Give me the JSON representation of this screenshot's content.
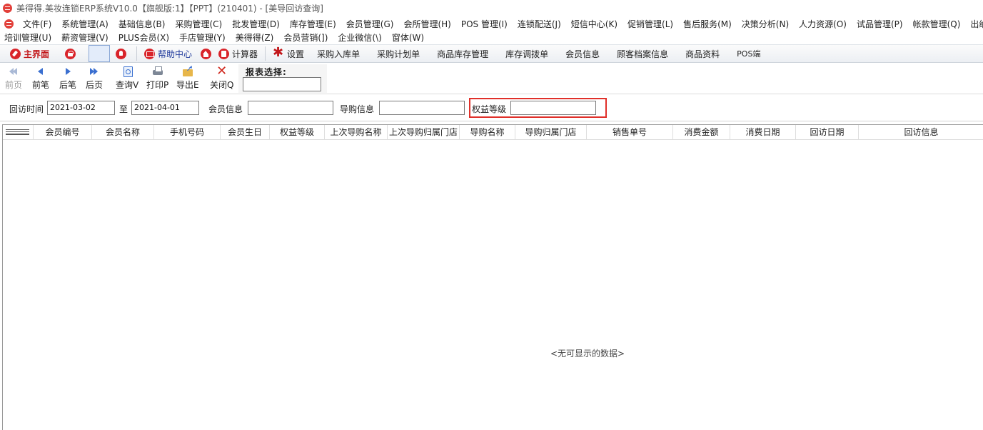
{
  "window": {
    "title": "美得得.美妆连锁ERP系统V10.0【旗舰版:1】【PPT】(210401) - [美导回访查询]"
  },
  "menu": {
    "row1": [
      "文件(F)",
      "系统管理(A)",
      "基础信息(B)",
      "采购管理(C)",
      "批发管理(D)",
      "库存管理(E)",
      "会员管理(G)",
      "会所管理(H)",
      "POS 管理(I)",
      "连锁配送(J)",
      "短信中心(K)",
      "促销管理(L)",
      "售后服务(M)",
      "决策分析(N)",
      "人力资源(O)",
      "试品管理(P)",
      "帐款管理(Q)",
      "出纳管理"
    ],
    "row2": [
      "培训管理(U)",
      "薪资管理(V)",
      "PLUS会员(X)",
      "手店管理(Y)",
      "美得得(Z)",
      "会员营销(])",
      "企业微信(\\)",
      "窗体(W)"
    ]
  },
  "quickbar": {
    "home": "主界面",
    "help": "帮助中心",
    "calculator": "计算器",
    "settings": "设置",
    "links": [
      "采购入库单",
      "采购计划单",
      "商品库存管理",
      "库存调拨单",
      "会员信息",
      "顾客档案信息",
      "商品资料"
    ],
    "pos": "POS端"
  },
  "toolbar": {
    "first": "前页",
    "prev": "前笔",
    "next": "后笔",
    "last": "后页",
    "query": "查询V",
    "print": "打印P",
    "export": "导出E",
    "close": "关闭Q",
    "report_label": "报表选择:",
    "report_value": ""
  },
  "filter": {
    "visit_time_label": "回访时间",
    "date_from": "2021-03-02",
    "to_label": "至",
    "date_to": "2021-04-01",
    "member_info_label": "会员信息",
    "member_info_value": "",
    "guide_info_label": "导购信息",
    "guide_info_value": "",
    "benefit_level_label": "权益等级",
    "benefit_level_value": ""
  },
  "grid": {
    "columns": [
      "会员编号",
      "会员名称",
      "手机号码",
      "会员生日",
      "权益等级",
      "上次导购名称",
      "上次导购归属门店",
      "导购名称",
      "导购归属门店",
      "销售单号",
      "消费金额",
      "消费日期",
      "回访日期",
      "回访信息"
    ],
    "empty_message": "<无可显示的数据>"
  },
  "colors": {
    "accent_red": "#d9242a",
    "highlight_border": "#e0302a",
    "icon_blue": "#3a6fd0"
  }
}
